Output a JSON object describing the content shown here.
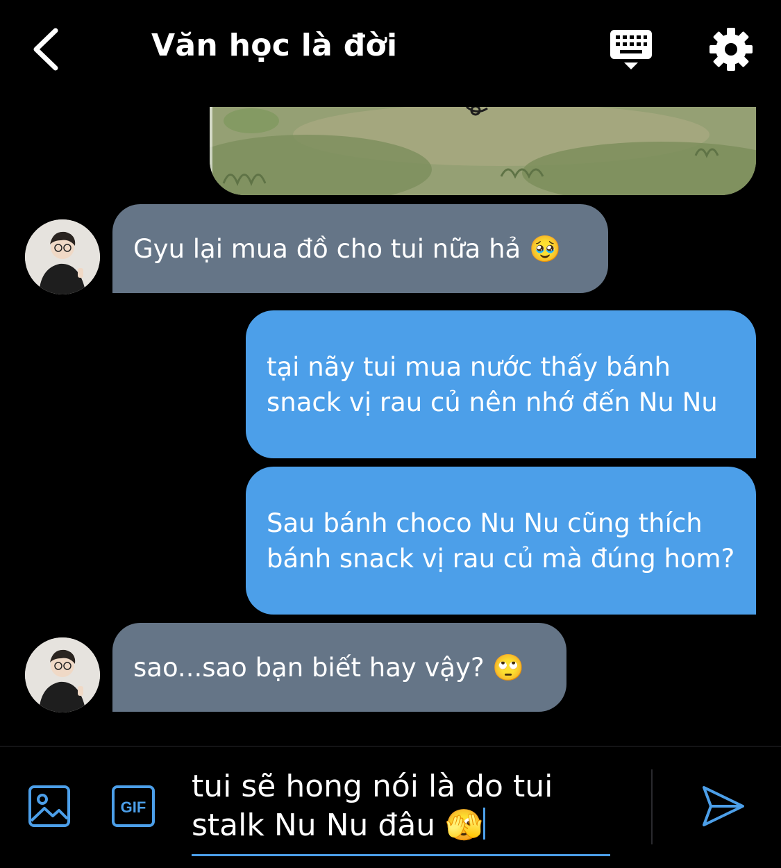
{
  "header": {
    "title": "Văn học là đời",
    "back_icon": "chevron-left-icon",
    "keyboard_icon": "keyboard-icon",
    "settings_icon": "gear-icon"
  },
  "messages": [
    {
      "type": "image",
      "from": "me"
    },
    {
      "type": "text",
      "from": "them",
      "text": "Gyu lại mua đồ cho tui nữa hả 🥹"
    },
    {
      "type": "text",
      "from": "me",
      "text": "tại nãy tui mua nước thấy bánh snack vị rau củ nên nhớ đến Nu Nu"
    },
    {
      "type": "text",
      "from": "me",
      "text": "Sau bánh choco Nu Nu cũng thích bánh snack vị rau củ mà đúng hom?"
    },
    {
      "type": "text",
      "from": "them",
      "text": "sao...sao bạn biết hay vậy? 🙄"
    }
  ],
  "composer": {
    "image_icon": "image-icon",
    "gif_icon": "gif-icon",
    "gif_label": "GIF",
    "draft": "tui sẽ hong nói là do tui stalk Nu Nu đâu 🫣",
    "send_icon": "send-icon"
  },
  "colors": {
    "background": "#000000",
    "incoming_bubble": "#657587",
    "outgoing_bubble": "#4c9fe9",
    "accent": "#4c9fe9"
  }
}
